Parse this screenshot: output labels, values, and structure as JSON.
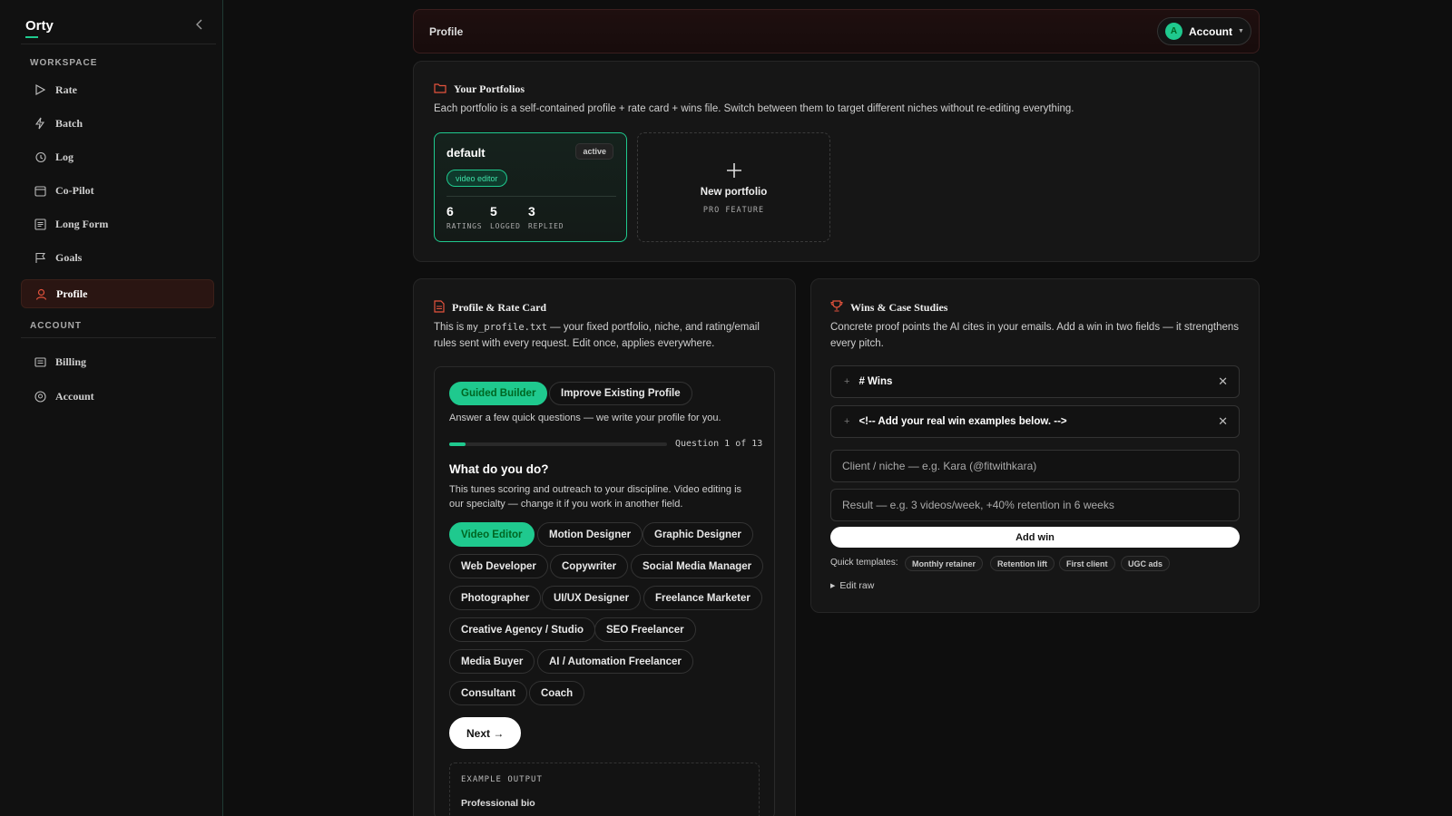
{
  "app": {
    "name": "Orty"
  },
  "sidebar": {
    "workspace_label": "WORKSPACE",
    "account_label": "ACCOUNT",
    "workspace_items": [
      {
        "label": "Rate",
        "icon": "play-icon"
      },
      {
        "label": "Batch",
        "icon": "lightning-icon"
      },
      {
        "label": "Log",
        "icon": "history-icon"
      },
      {
        "label": "Co-Pilot",
        "icon": "calendar-icon"
      },
      {
        "label": "Long Form",
        "icon": "document-icon"
      },
      {
        "label": "Goals",
        "icon": "flag-icon"
      },
      {
        "label": "Profile",
        "icon": "user-icon",
        "active": true
      }
    ],
    "account_items": [
      {
        "label": "Billing",
        "icon": "billing-icon"
      },
      {
        "label": "Account",
        "icon": "account-circle-icon"
      }
    ]
  },
  "header": {
    "title": "Profile",
    "account": {
      "avatar_letter": "A",
      "label": "Account"
    }
  },
  "portfolios": {
    "title": "Your Portfolios",
    "description": "Each portfolio is a self-contained profile + rate card + wins file. Switch between them to target different niches without re-editing everything.",
    "items": [
      {
        "name": "default",
        "status": "active",
        "tag": "video editor",
        "stats": [
          {
            "value": "6",
            "label": "RATINGS"
          },
          {
            "value": "5",
            "label": "LOGGED"
          },
          {
            "value": "3",
            "label": "REPLIED"
          }
        ]
      }
    ],
    "new": {
      "label": "New portfolio",
      "sub": "PRO FEATURE"
    }
  },
  "rate_card": {
    "title": "Profile & Rate Card",
    "desc_pre": "This is ",
    "desc_file": "my_profile.txt",
    "desc_post": " — your fixed portfolio, niche, and rating/email rules sent with every request. Edit once, applies everywhere.",
    "tabs": [
      "Guided Builder",
      "Improve Existing Profile"
    ],
    "intro": "Answer a few quick questions — we write your profile for you.",
    "progress": {
      "current": 1,
      "total": 13,
      "label": "Question 1 of 13"
    },
    "question": "What do you do?",
    "question_desc": "This tunes scoring and outreach to your discipline. Video editing is our specialty — change it if you work in another field.",
    "options": [
      "Video Editor",
      "Motion Designer",
      "Graphic Designer",
      "Web Developer",
      "Copywriter",
      "Social Media Manager",
      "Photographer",
      "UI/UX Designer",
      "Freelance Marketer",
      "Creative Agency / Studio",
      "SEO Freelancer",
      "Media Buyer",
      "AI / Automation Freelancer",
      "Consultant",
      "Coach"
    ],
    "selected": "Video Editor",
    "next_label": "Next →",
    "example": {
      "label": "EXAMPLE OUTPUT",
      "heading": "Professional bio"
    }
  },
  "wins": {
    "title": "Wins & Case Studies",
    "description": "Concrete proof points the AI cites in your emails. Add a win in two fields — it strengthens every pitch.",
    "rows": [
      "# Wins",
      "<!-- Add your real win examples below. -->"
    ],
    "client_placeholder": "Client / niche — e.g. Kara (@fitwithkara)",
    "result_placeholder": "Result — e.g. 3 videos/week, +40% retention in 6 weeks",
    "add_label": "Add win",
    "templates_label": "Quick templates:",
    "templates": [
      "Monthly retainer",
      "Retention lift",
      "First client",
      "UGC ads"
    ],
    "edit_raw": "Edit raw"
  },
  "colors": {
    "accent": "#1fc98e",
    "danger": "#e5533d",
    "background": "#0e0e0e",
    "card": "#161616"
  }
}
